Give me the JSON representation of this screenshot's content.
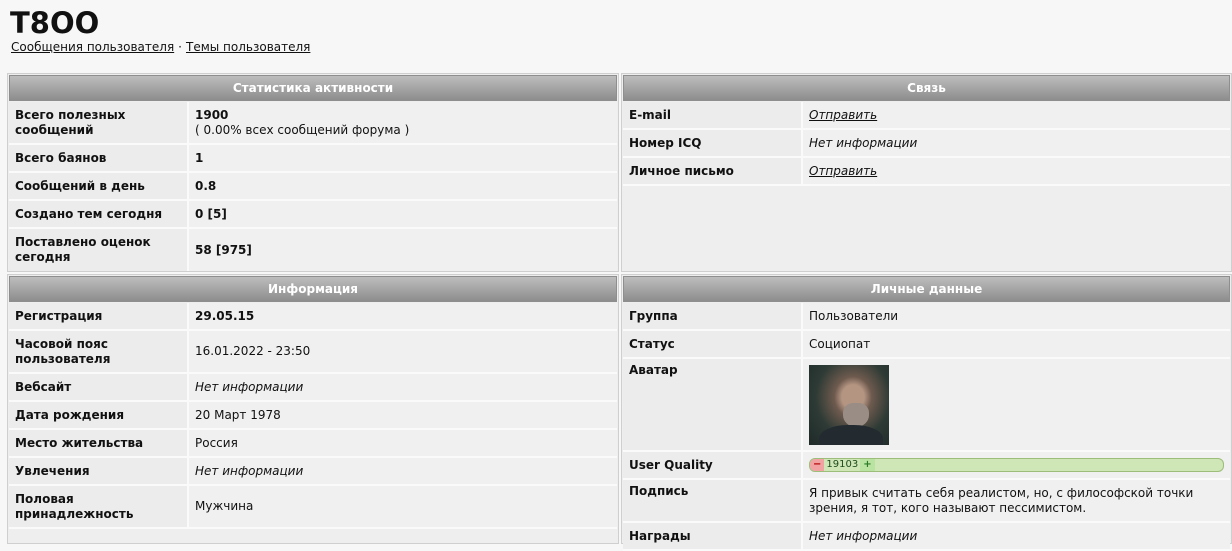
{
  "header": {
    "username": "T8OO",
    "link_messages": "Сообщения пользователя",
    "separator": "·",
    "link_topics": "Темы пользователя"
  },
  "stats": {
    "title": "Статистика активности",
    "rows": [
      {
        "key": "Всего полезных сообщений",
        "value": "1900",
        "sub": "( 0.00% всех сообщений форума )"
      },
      {
        "key": "Всего баянов",
        "value": "1"
      },
      {
        "key": "Сообщений в день",
        "value": "0.8"
      },
      {
        "key": "Создано тем сегодня",
        "value": "0 [5]"
      },
      {
        "key": "Поставлено оценок сегодня",
        "value": "58 [975]"
      }
    ]
  },
  "contact": {
    "title": "Связь",
    "rows": [
      {
        "key": "E-mail",
        "value": "Отправить"
      },
      {
        "key": "Номер ICQ",
        "value": "Нет информации"
      },
      {
        "key": "Личное письмо",
        "value": "Отправить"
      }
    ]
  },
  "info": {
    "title": "Информация",
    "rows": [
      {
        "key": "Регистрация",
        "value": "29.05.15"
      },
      {
        "key": "Часовой пояс пользователя",
        "value": "16.01.2022 - 23:50"
      },
      {
        "key": "Вебсайт",
        "value": "Нет информации"
      },
      {
        "key": "Дата рождения",
        "value": "20 Март 1978"
      },
      {
        "key": "Место жительства",
        "value": "Россия"
      },
      {
        "key": "Увлечения",
        "value": "Нет информации"
      },
      {
        "key": "Половая принадлежность",
        "value": "Мужчина"
      }
    ]
  },
  "personal": {
    "title": "Личные данные",
    "rows": [
      {
        "key": "Группа",
        "value": "Пользователи"
      },
      {
        "key": "Статус",
        "value": "Социопат"
      },
      {
        "key": "Аватар"
      },
      {
        "key": "User Quality",
        "minus": "−",
        "value": "19103",
        "plus": "+"
      },
      {
        "key": "Подпись",
        "value": "Я привык считать себя реалистом, но, с философской точки зрения, я тот, кого называют пессимистом."
      },
      {
        "key": "Награды",
        "value": "Нет информации"
      }
    ]
  }
}
